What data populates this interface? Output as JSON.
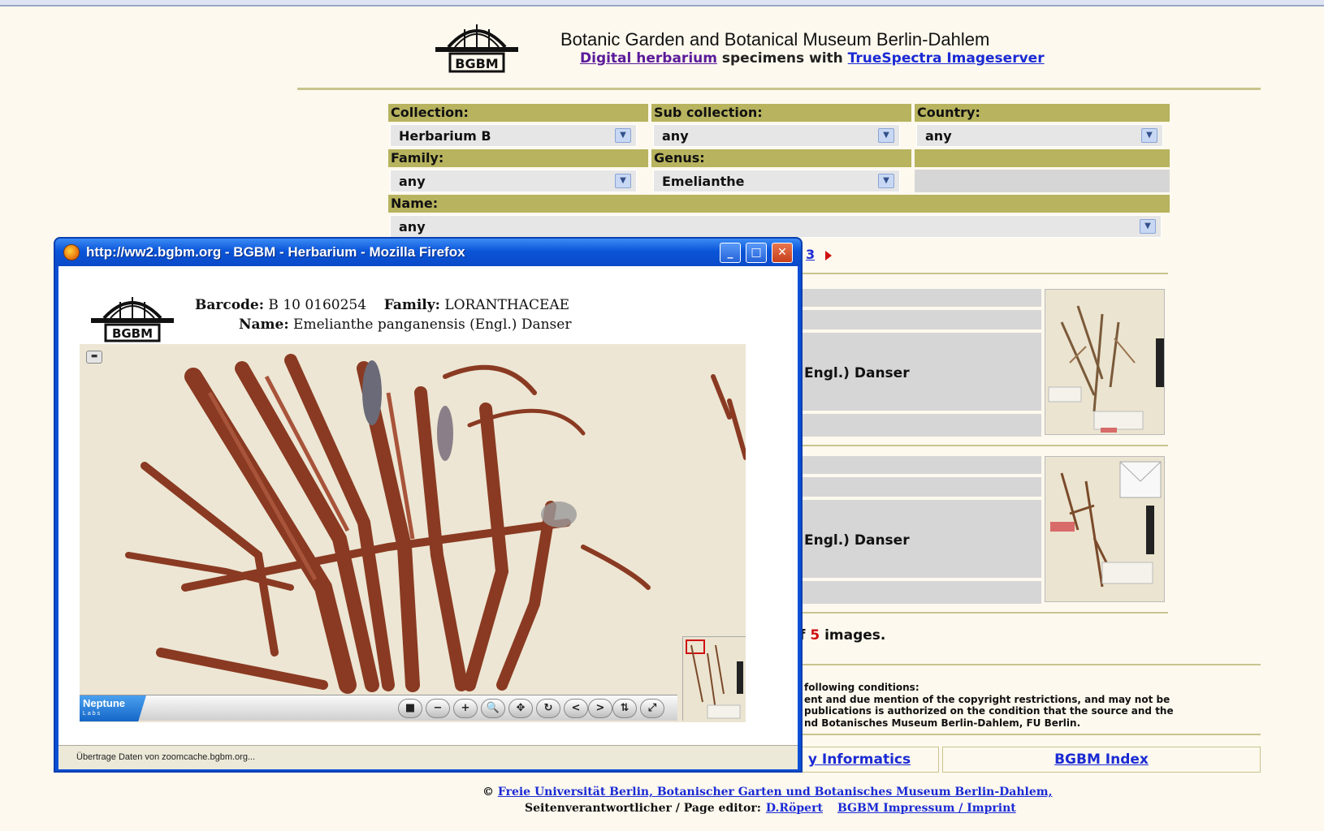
{
  "header": {
    "title": "Botanic Garden and Botanical Museum Berlin-Dahlem",
    "sub_link1": "Digital herbarium",
    "sub_middle": " specimens with ",
    "sub_link2": "TrueSpectra Imageserver",
    "logo_text": "BGBM"
  },
  "filters": {
    "collection_label": "Collection:",
    "collection_value": "Herbarium B",
    "subcollection_label": "Sub collection:",
    "subcollection_value": "any",
    "country_label": "Country:",
    "country_value": "any",
    "family_label": "Family:",
    "family_value": "any",
    "genus_label": "Genus:",
    "genus_value": "Emelianthe",
    "name_label": "Name:",
    "name_value": "any"
  },
  "results": {
    "pager_text": "3",
    "row1_name": "Engl.) Danser",
    "row2_name": "Engl.) Danser",
    "count_prefix": "f ",
    "count_number": "5",
    "count_suffix": " images."
  },
  "conditions": {
    "line1": "following conditions:",
    "line2": "ent and due mention of the copyright restrictions, and may not be",
    "line3": "publications is authorized on the condition that the source and the",
    "line4": "nd Botanisches Museum Berlin-Dahlem, FU Berlin."
  },
  "bottom_nav": {
    "informatics": "y Informatics",
    "index": "BGBM Index"
  },
  "footer": {
    "copyright_symbol": "©",
    "copyright_link": "Freie Universität Berlin, Botanischer Garten und Botanisches Museum Berlin-Dahlem,",
    "editor_label": "Seitenverantwortlicher / Page editor:",
    "editor_link": "D.Röpert",
    "imprint_link": "BGBM Impressum / Imprint"
  },
  "popup": {
    "window_title": "http://ww2.bgbm.org - BGBM - Herbarium - Mozilla Firefox",
    "barcode_label": "Barcode:",
    "barcode_value": "B 10 0160254",
    "family_label": "Family:",
    "family_value": "LORANTHACEAE",
    "name_label": "Name:",
    "name_value": "Emelianthe panganensis (Engl.) Danser",
    "logo_text": "BGBM",
    "viewer_brand": "Neptune",
    "viewer_brand_sub": "Labs",
    "status_text": "Übertrage Daten von zoomcache.bgbm.org...",
    "tools": [
      "■",
      "−",
      "+",
      "🔍",
      "✥",
      "↻",
      "<",
      ">",
      "⇅",
      "⤢"
    ]
  },
  "colors": {
    "page_bg": "#fdf9ee",
    "label_bg": "#b7b35e",
    "link": "#1a2ad4",
    "accent_red": "#d01010",
    "xp_blue": "#0a55d8"
  }
}
